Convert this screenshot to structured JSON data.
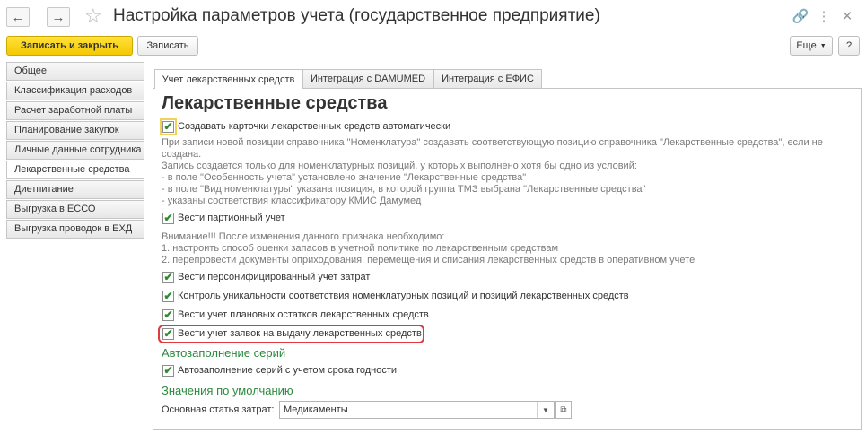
{
  "window": {
    "title": "Настройка параметров учета (государственное предприятие)",
    "icons": [
      "back-arrow-icon",
      "forward-arrow-icon",
      "star-icon",
      "link-icon",
      "more-vertical-icon",
      "close-icon"
    ]
  },
  "toolbar": {
    "save_close_label": "Записать и закрыть",
    "save_label": "Записать",
    "more_label": "Еще",
    "help_label": "?"
  },
  "sidebar": {
    "items": [
      {
        "label": "Общее"
      },
      {
        "label": "Классификация расходов"
      },
      {
        "label": "Расчет заработной платы"
      },
      {
        "label": "Планирование закупок"
      },
      {
        "label": "Личные данные сотрудника"
      },
      {
        "label": "Лекарственные средства",
        "active": true
      },
      {
        "label": "Диетпитание"
      },
      {
        "label": "Выгрузка в ЕССО"
      },
      {
        "label": "Выгрузка проводок в ЕХД"
      }
    ]
  },
  "tabs": [
    {
      "label": "Учет лекарственных средств",
      "active": true
    },
    {
      "label": "Интеграция с DAMUMED"
    },
    {
      "label": "Интеграция с ЕФИС"
    }
  ],
  "content": {
    "heading": "Лекарственные средства",
    "auto_cards": {
      "label": "Создавать карточки лекарственных средств автоматически",
      "checked": true,
      "notes": [
        "При записи новой позиции справочника \"Номенклатура\" создавать соответствующую позицию справочника \"Лекарственные средства\", если не",
        "создана.",
        "Запись создается только для номенклатурных позиций, у которых выполнено хотя бы одно из условий:",
        "- в поле \"Особенность учета\" установлено значение \"Лекарственные средства\"",
        "- в поле \"Вид номенклатуры\" указана позиция, в которой группа ТМЗ выбрана \"Лекарственные средства\"",
        "- указаны соответствия классификатору КМИС Дамумед"
      ]
    },
    "batch": {
      "label": "Вести партионный учет",
      "checked": true,
      "notes": [
        "Внимание!!! После изменения данного признака необходимо:",
        "1. настроить способ оценки запасов в учетной политике по лекарственным средствам",
        "2. перепровести документы оприходования, перемещения и списания лекарственных средств в оперативном учете"
      ]
    },
    "personified": {
      "label": "Вести персонифицированный учет затрат",
      "checked": true
    },
    "uniqueness": {
      "label": "Контроль уникальности соответствия номенклатурных позиций и позиций лекарственных средств",
      "checked": true
    },
    "planned": {
      "label": "Вести учет плановых остатков лекарственных средств",
      "checked": true
    },
    "requests": {
      "label": "Вести учет заявок на выдачу лекарственных средств",
      "checked": true
    },
    "series_section": "Автозаполнение серий",
    "series_auto": {
      "label": "Автозаполнение серий с учетом срока годности",
      "checked": true
    },
    "defaults_section": "Значения по умолчанию",
    "cost_item": {
      "label": "Основная статья затрат:",
      "value": "Медикаменты"
    }
  },
  "colors": {
    "primary_button": "#f5c800",
    "section_heading": "#2b8a3e",
    "highlight_border": "#e0393e",
    "checkmark": "#2e8b2e"
  }
}
